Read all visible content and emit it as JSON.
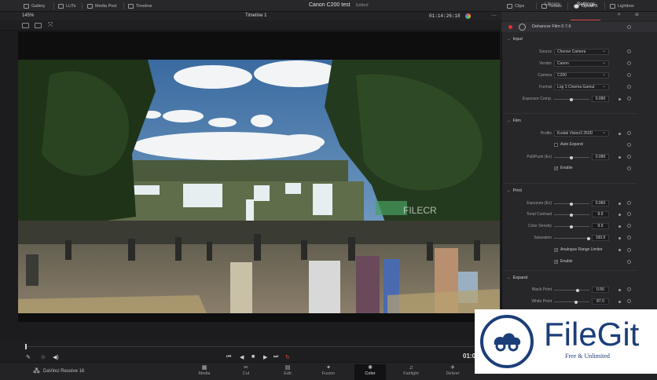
{
  "topbar": {
    "gallery": "Gallery",
    "luts": "LUTs",
    "media_pool": "Media Pool",
    "timeline": "Timeline",
    "project": "Canon C200 test",
    "project_state": "Edited",
    "clips": "Clips",
    "nodes": "Nodes",
    "openfx": "OpenFX",
    "lightbox": "Lightbox"
  },
  "viewer": {
    "zoom": "145%",
    "timeline_name": "Timeline 1",
    "timecode": "01:14:26:18",
    "timecode_end": "01:0"
  },
  "panel": {
    "tabs": [
      "Library",
      "Settings"
    ],
    "effect_name": "Dehancer Film 0.7.6",
    "input": {
      "title": "Input",
      "source_label": "Source",
      "source_value": "Choose Camera",
      "vendor_label": "Vendor",
      "vendor_value": "Canon",
      "camera_label": "Camera",
      "camera_value": "C200",
      "format_label": "Format",
      "format_value": "Log 3 Cinema Gamut",
      "exposure_label": "Exposure Comp.",
      "exposure_value": "0.090"
    },
    "film": {
      "title": "Film",
      "profile_label": "Profile",
      "profile_value": "Kodak Vision3 250D",
      "auto_expand": "Auto Expand",
      "pullpush_label": "Pull/Push (Ev)",
      "pullpush_value": "0.090",
      "enable": "Enable"
    },
    "print": {
      "title": "Print",
      "exposure_label": "Exposure (Ev)",
      "exposure_value": "0.060",
      "tonal_label": "Tonal Contrast",
      "tonal_value": "9.9",
      "density_label": "Color Density",
      "density_value": "9.9",
      "saturation_label": "Saturation",
      "saturation_value": "100.0",
      "limiter": "Analogue Range Limiter",
      "enable": "Enable"
    },
    "expand": {
      "title": "Expand",
      "black_label": "Black Point",
      "black_value": "0.56",
      "white_label": "White Point",
      "white_value": "87.0"
    }
  },
  "pages": {
    "app_name": "DaVinci Resolve 16",
    "items": [
      "Media",
      "Cut",
      "Edit",
      "Fusion",
      "Color",
      "Fairlight",
      "Deliver"
    ],
    "active": "Color"
  },
  "watermark": {
    "title": "FileGit",
    "subtitle": "Free & Unlimited",
    "scene_mark": "FILECR"
  }
}
